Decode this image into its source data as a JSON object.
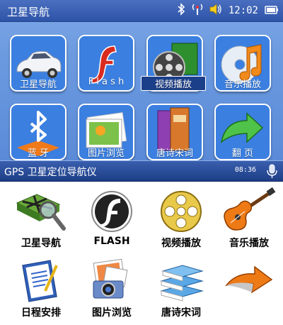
{
  "titlebar": {
    "title": "卫星导航",
    "time": "12:02"
  },
  "top_menu": [
    {
      "label": "卫星导航"
    },
    {
      "label": "F l a s h"
    },
    {
      "label": "视频播放"
    },
    {
      "label": "音乐播放"
    },
    {
      "label": "蓝    牙"
    },
    {
      "label": "图片浏览"
    },
    {
      "label": "唐诗宋词"
    },
    {
      "label": "翻    页"
    }
  ],
  "infobar": {
    "title": "GPS 卫星定位导航仪",
    "time": "08:36"
  },
  "bottom_menu": [
    {
      "label": "卫星导航"
    },
    {
      "label": "FLASH"
    },
    {
      "label": "视频播放"
    },
    {
      "label": "音乐播放"
    },
    {
      "label": "日程安排"
    },
    {
      "label": "图片浏览"
    },
    {
      "label": "唐诗宋词"
    },
    {
      "label": ""
    }
  ],
  "colors": {
    "title_bar": "#2e54a8",
    "panel": "#6b9ae0",
    "tile": "#1f5fc8",
    "info_bar": "#1d3e86"
  }
}
